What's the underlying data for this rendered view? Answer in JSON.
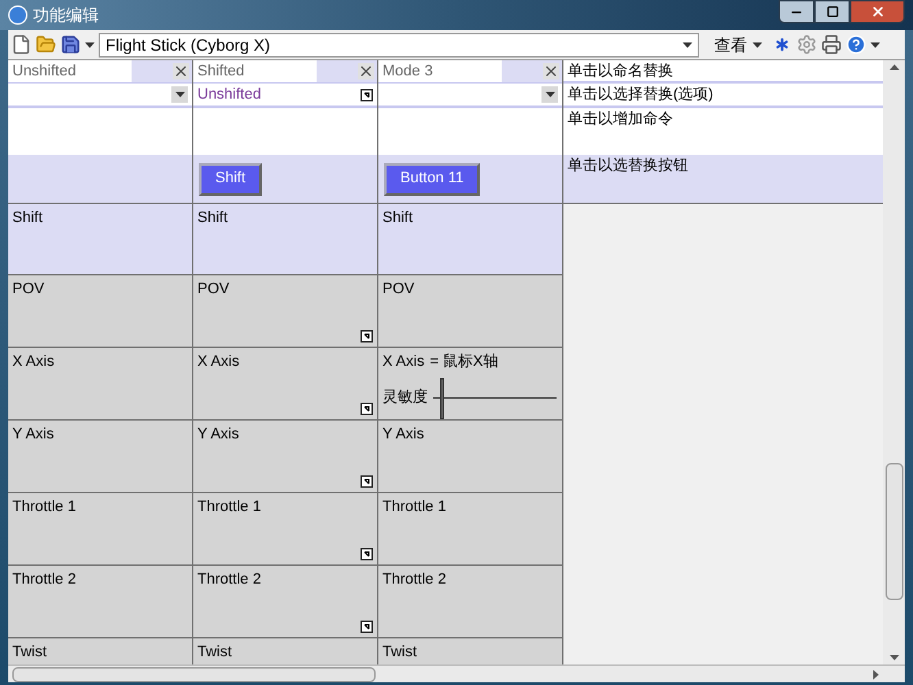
{
  "window": {
    "title": "功能编辑"
  },
  "toolbar": {
    "profile": "Flight Stick (Cyborg X)",
    "view_menu": "查看"
  },
  "modes": [
    {
      "name": "Unshifted",
      "source": {
        "kind": "dropdown"
      }
    },
    {
      "name": "Shifted",
      "source": {
        "kind": "linked",
        "text": "Unshifted"
      },
      "button": "Shift"
    },
    {
      "name": "Mode 3",
      "source": {
        "kind": "dropdown"
      },
      "button": "Button 11"
    }
  ],
  "hints": [
    "单击以命名替换",
    "单击以选择替换(选项)",
    "单击以增加命令",
    "单击以选替换按钮"
  ],
  "rows": [
    {
      "highlighted": true,
      "cells": [
        {
          "text": "Shift",
          "linked": false
        },
        {
          "text": "Shift",
          "linked": false
        },
        {
          "text": "Shift",
          "linked": false
        }
      ]
    },
    {
      "highlighted": false,
      "cells": [
        {
          "text": "POV",
          "linked": false
        },
        {
          "text": "POV",
          "linked": true
        },
        {
          "text": "POV",
          "linked": false
        }
      ]
    },
    {
      "highlighted": false,
      "cells": [
        {
          "text": "X Axis",
          "linked": false
        },
        {
          "text": "X Axis",
          "linked": true
        },
        {
          "text": "X Axis",
          "linked": false,
          "mapping": "= 鼠标X轴",
          "slider_label": "灵敏度",
          "level": 0.05
        }
      ]
    },
    {
      "highlighted": false,
      "cells": [
        {
          "text": "Y Axis",
          "linked": false
        },
        {
          "text": "Y Axis",
          "linked": true
        },
        {
          "text": "Y Axis",
          "linked": false
        }
      ]
    },
    {
      "highlighted": false,
      "cells": [
        {
          "text": "Throttle 1",
          "linked": false
        },
        {
          "text": "Throttle 1",
          "linked": true
        },
        {
          "text": "Throttle 1",
          "linked": false
        }
      ]
    },
    {
      "highlighted": false,
      "cells": [
        {
          "text": "Throttle 2",
          "linked": false
        },
        {
          "text": "Throttle 2",
          "linked": true
        },
        {
          "text": "Throttle 2",
          "linked": false
        }
      ]
    },
    {
      "highlighted": false,
      "cells": [
        {
          "text": "Twist"
        },
        {
          "text": "Twist"
        },
        {
          "text": "Twist"
        }
      ]
    }
  ]
}
